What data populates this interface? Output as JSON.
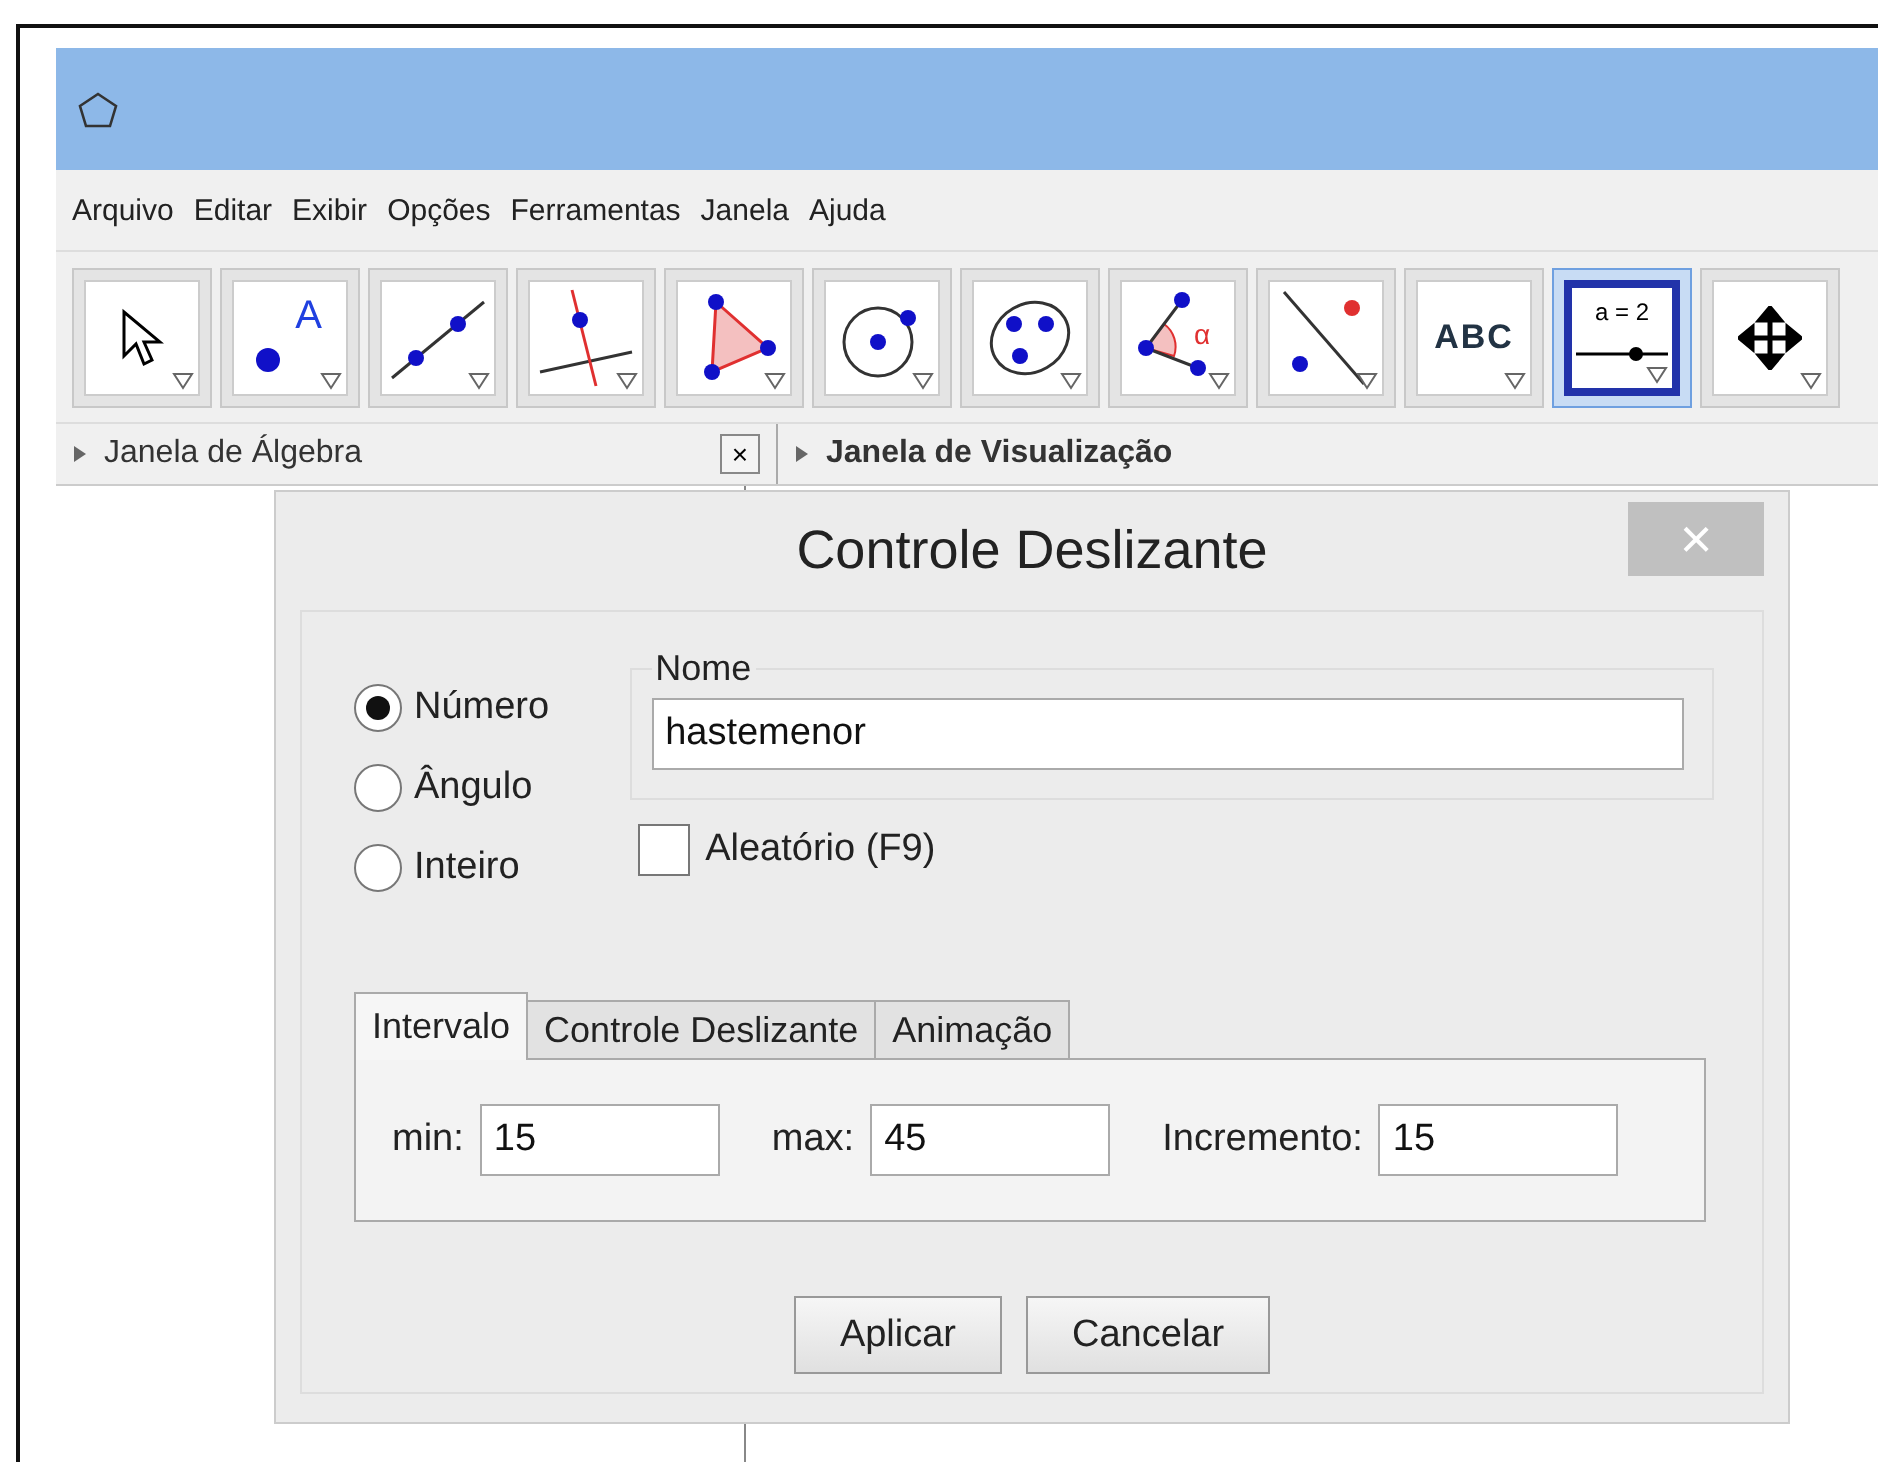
{
  "menu": [
    "Arquivo",
    "Editar",
    "Exibir",
    "Opções",
    "Ferramentas",
    "Janela",
    "Ajuda"
  ],
  "tools": [
    {
      "kind": "move",
      "selected": false
    },
    {
      "kind": "point",
      "label": "A",
      "selected": false
    },
    {
      "kind": "line",
      "selected": false
    },
    {
      "kind": "perpendicular",
      "selected": false
    },
    {
      "kind": "polygon",
      "selected": false
    },
    {
      "kind": "circle",
      "selected": false
    },
    {
      "kind": "conic",
      "selected": false
    },
    {
      "kind": "angle",
      "label": "α",
      "selected": false
    },
    {
      "kind": "reflect",
      "selected": false
    },
    {
      "kind": "text",
      "label": "ABC",
      "selected": false
    },
    {
      "kind": "slider",
      "label": "a = 2",
      "selected": true
    },
    {
      "kind": "pan",
      "selected": false
    }
  ],
  "panels": [
    {
      "title": "Janela de Álgebra",
      "bold": false,
      "close": "×"
    },
    {
      "title": "Janela de Visualização",
      "bold": true
    }
  ],
  "dialog": {
    "title": "Controle Deslizante",
    "close": "×",
    "types": [
      {
        "label": "Número",
        "selected": true
      },
      {
        "label": "Ângulo",
        "selected": false
      },
      {
        "label": "Inteiro",
        "selected": false
      }
    ],
    "name_legend": "Nome",
    "name_value": "hastemenor",
    "random": {
      "label": "Aleatório (F9)",
      "checked": false
    },
    "tabs": [
      {
        "label": "Intervalo",
        "selected": true
      },
      {
        "label": "Controle Deslizante",
        "selected": false
      },
      {
        "label": "Animação",
        "selected": false
      }
    ],
    "fields": [
      {
        "label": "min:",
        "value": "15"
      },
      {
        "label": "max:",
        "value": "45"
      },
      {
        "label": "Incremento:",
        "value": "15"
      }
    ],
    "buttons": [
      "Aplicar",
      "Cancelar"
    ]
  }
}
